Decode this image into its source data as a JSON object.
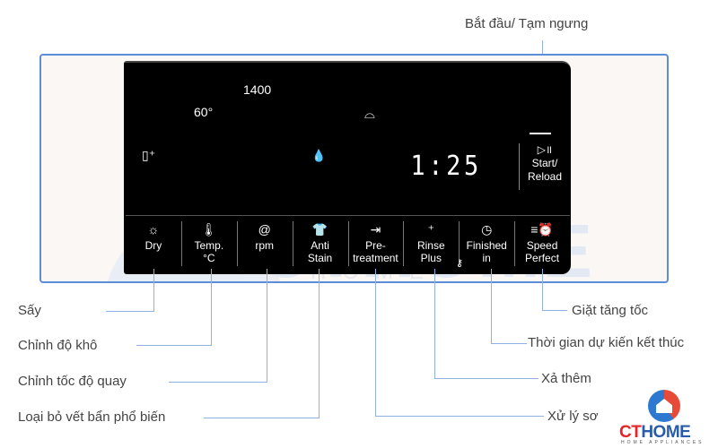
{
  "panel": {
    "spin_value": "1400",
    "temp_value": "60°",
    "time_display": "1:25",
    "icons": [
      "wardrobe-plus-icon",
      "basket-icon",
      "water-drop-icon"
    ],
    "start_button": {
      "icon": "play-pause-icon",
      "label_line1": "Start/",
      "label_line2": "Reload"
    },
    "buttons": [
      {
        "icon": "sun-icon",
        "glyph": "☼",
        "line1": "Dry",
        "line2": ""
      },
      {
        "icon": "thermometer-icon",
        "glyph": "🌡",
        "line1": "Temp.",
        "line2": "°C"
      },
      {
        "icon": "spiral-icon",
        "glyph": "@",
        "line1": "rpm",
        "line2": ""
      },
      {
        "icon": "shirt-icon",
        "glyph": "👕",
        "line1": "Anti",
        "line2": "Stain"
      },
      {
        "icon": "basin-arrow-icon",
        "glyph": "⇥",
        "line1": "Pre-",
        "line2": "treatment"
      },
      {
        "icon": "rinse-plus-icon",
        "glyph": "⁺",
        "line1": "Rinse",
        "line2": "Plus"
      },
      {
        "icon": "clock-icon",
        "glyph": "◷",
        "line1": "Finished",
        "line2": "in"
      },
      {
        "icon": "speed-alarm-icon",
        "glyph": "≡⏰",
        "line1": "Speed",
        "line2": "Perfect"
      }
    ],
    "key_icon": "key-icon"
  },
  "annotations": {
    "top": "Bắt đầu/ Tạm ngưng",
    "left": [
      "Sấy",
      "Chỉnh độ khô",
      "Chỉnh tốc độ quay",
      "Loại bỏ vết bẩn phổ biến"
    ],
    "right": [
      "Giặt tăng tốc",
      "Thời gian dự kiến kết thúc",
      "Xả thêm",
      "Xử lý sơ"
    ]
  },
  "watermark": {
    "brand": "CTHOME",
    "sub": "HOME APPLIANCES"
  },
  "logo": {
    "ct": "CT",
    "home": "HOME",
    "sub": "HOME APPLIANCES"
  },
  "colors": {
    "frame": "#5b8dd9",
    "leader": "#8fb0e3",
    "panel": "#000000",
    "logo_red": "#e5252a",
    "logo_blue": "#2a5caa"
  }
}
